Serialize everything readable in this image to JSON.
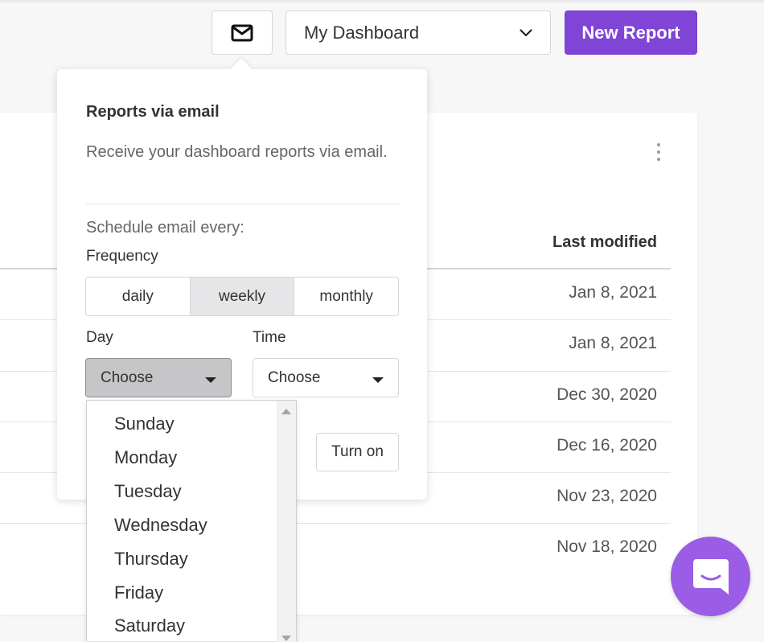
{
  "header": {
    "email_icon": "envelope-icon",
    "dashboard_select": {
      "value": "My Dashboard",
      "icon": "chevron-down-icon"
    },
    "new_report_label": "New Report",
    "accent_color": "#8044d6"
  },
  "table": {
    "column_header": "Last modified",
    "rows": [
      {
        "last_modified": "Jan 8, 2021"
      },
      {
        "last_modified": "Jan 8, 2021"
      },
      {
        "last_modified": "Dec 30, 2020"
      },
      {
        "last_modified": "Dec 16, 2020"
      },
      {
        "last_modified": "Nov 23, 2020"
      },
      {
        "last_modified": "Nov 18, 2020"
      }
    ],
    "menu_icon": "kebab-menu-icon"
  },
  "email_popover": {
    "title": "Reports via email",
    "description": "Receive your dashboard reports via email.",
    "schedule_label": "Schedule email every:",
    "frequency_label": "Frequency",
    "frequency_options": [
      "daily",
      "weekly",
      "monthly"
    ],
    "frequency_selected": "weekly",
    "day_label": "Day",
    "day_value": "Choose",
    "time_label": "Time",
    "time_value": "Choose",
    "turn_on_label": "Turn on"
  },
  "day_dropdown": {
    "options": [
      "Sunday",
      "Monday",
      "Tuesday",
      "Wednesday",
      "Thursday",
      "Friday",
      "Saturday"
    ]
  },
  "chat": {
    "icon": "chat-icon",
    "color": "#9b5de5"
  }
}
